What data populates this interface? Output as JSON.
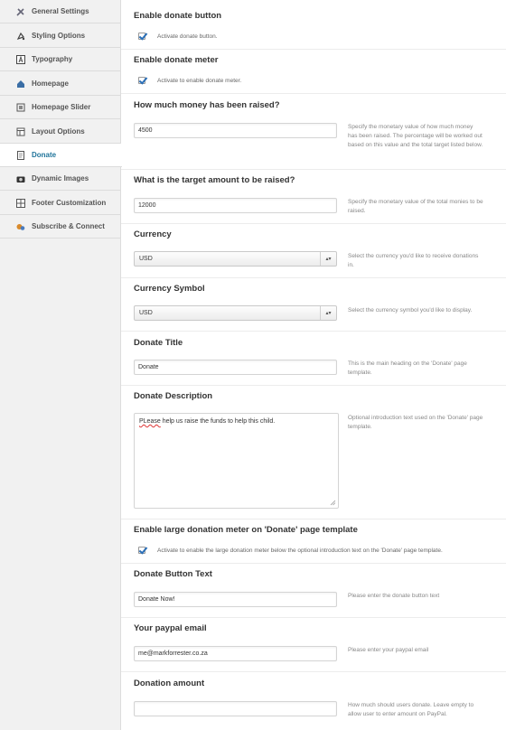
{
  "sidebar": {
    "items": [
      {
        "label": "General Settings",
        "icon": "tools-icon"
      },
      {
        "label": "Styling Options",
        "icon": "paint-icon"
      },
      {
        "label": "Typography",
        "icon": "font-icon"
      },
      {
        "label": "Homepage",
        "icon": "home-icon"
      },
      {
        "label": "Homepage Slider",
        "icon": "slider-icon"
      },
      {
        "label": "Layout Options",
        "icon": "layout-icon"
      },
      {
        "label": "Donate",
        "icon": "document-icon",
        "active": true
      },
      {
        "label": "Dynamic Images",
        "icon": "camera-icon"
      },
      {
        "label": "Footer Customization",
        "icon": "grid-icon"
      },
      {
        "label": "Subscribe & Connect",
        "icon": "connect-icon"
      }
    ]
  },
  "main": {
    "enable_donate_button": {
      "title": "Enable donate button",
      "label": "Activate donate button.",
      "checked": true
    },
    "enable_donate_meter": {
      "title": "Enable donate meter",
      "label": "Activate to enable donate meter.",
      "checked": true
    },
    "money_raised": {
      "title": "How much money has been raised?",
      "value": "4500",
      "help": "Specify the monetary value of how much money has been raised. The percentage will be worked out based on this value and the total target listed below."
    },
    "target_amount": {
      "title": "What is the target amount to be raised?",
      "value": "12000",
      "help": "Specify the monetary value of the total monies to be raised."
    },
    "currency": {
      "title": "Currency",
      "value": "USD",
      "help": "Select the currency you'd like to receive donations in."
    },
    "currency_symbol": {
      "title": "Currency Symbol",
      "value": "USD",
      "help": "Select the currency symbol you'd like to display."
    },
    "donate_title": {
      "title": "Donate Title",
      "value": "Donate",
      "help": "This is the main heading on the 'Donate' page template."
    },
    "donate_description": {
      "title": "Donate Description",
      "value_first_word": "PLease",
      "value_rest": " help us raise the funds to help this child.",
      "help": "Optional introduction text used on the 'Donate' page template."
    },
    "large_meter": {
      "title": "Enable large donation meter on 'Donate' page template",
      "label": "Activate to enable the large donation meter below the optional introduction text on the 'Donate' page template.",
      "checked": true
    },
    "button_text": {
      "title": "Donate Button Text",
      "value": "Donate Now!",
      "help": "Please enter the donate button text"
    },
    "paypal_email": {
      "title": "Your paypal email",
      "value": "me@markforrester.co.za",
      "help": "Please enter your paypal email"
    },
    "donation_amount": {
      "title": "Donation amount",
      "value": "",
      "help": "How much should users donate. Leave empty to allow user to enter amount on PayPal."
    }
  }
}
